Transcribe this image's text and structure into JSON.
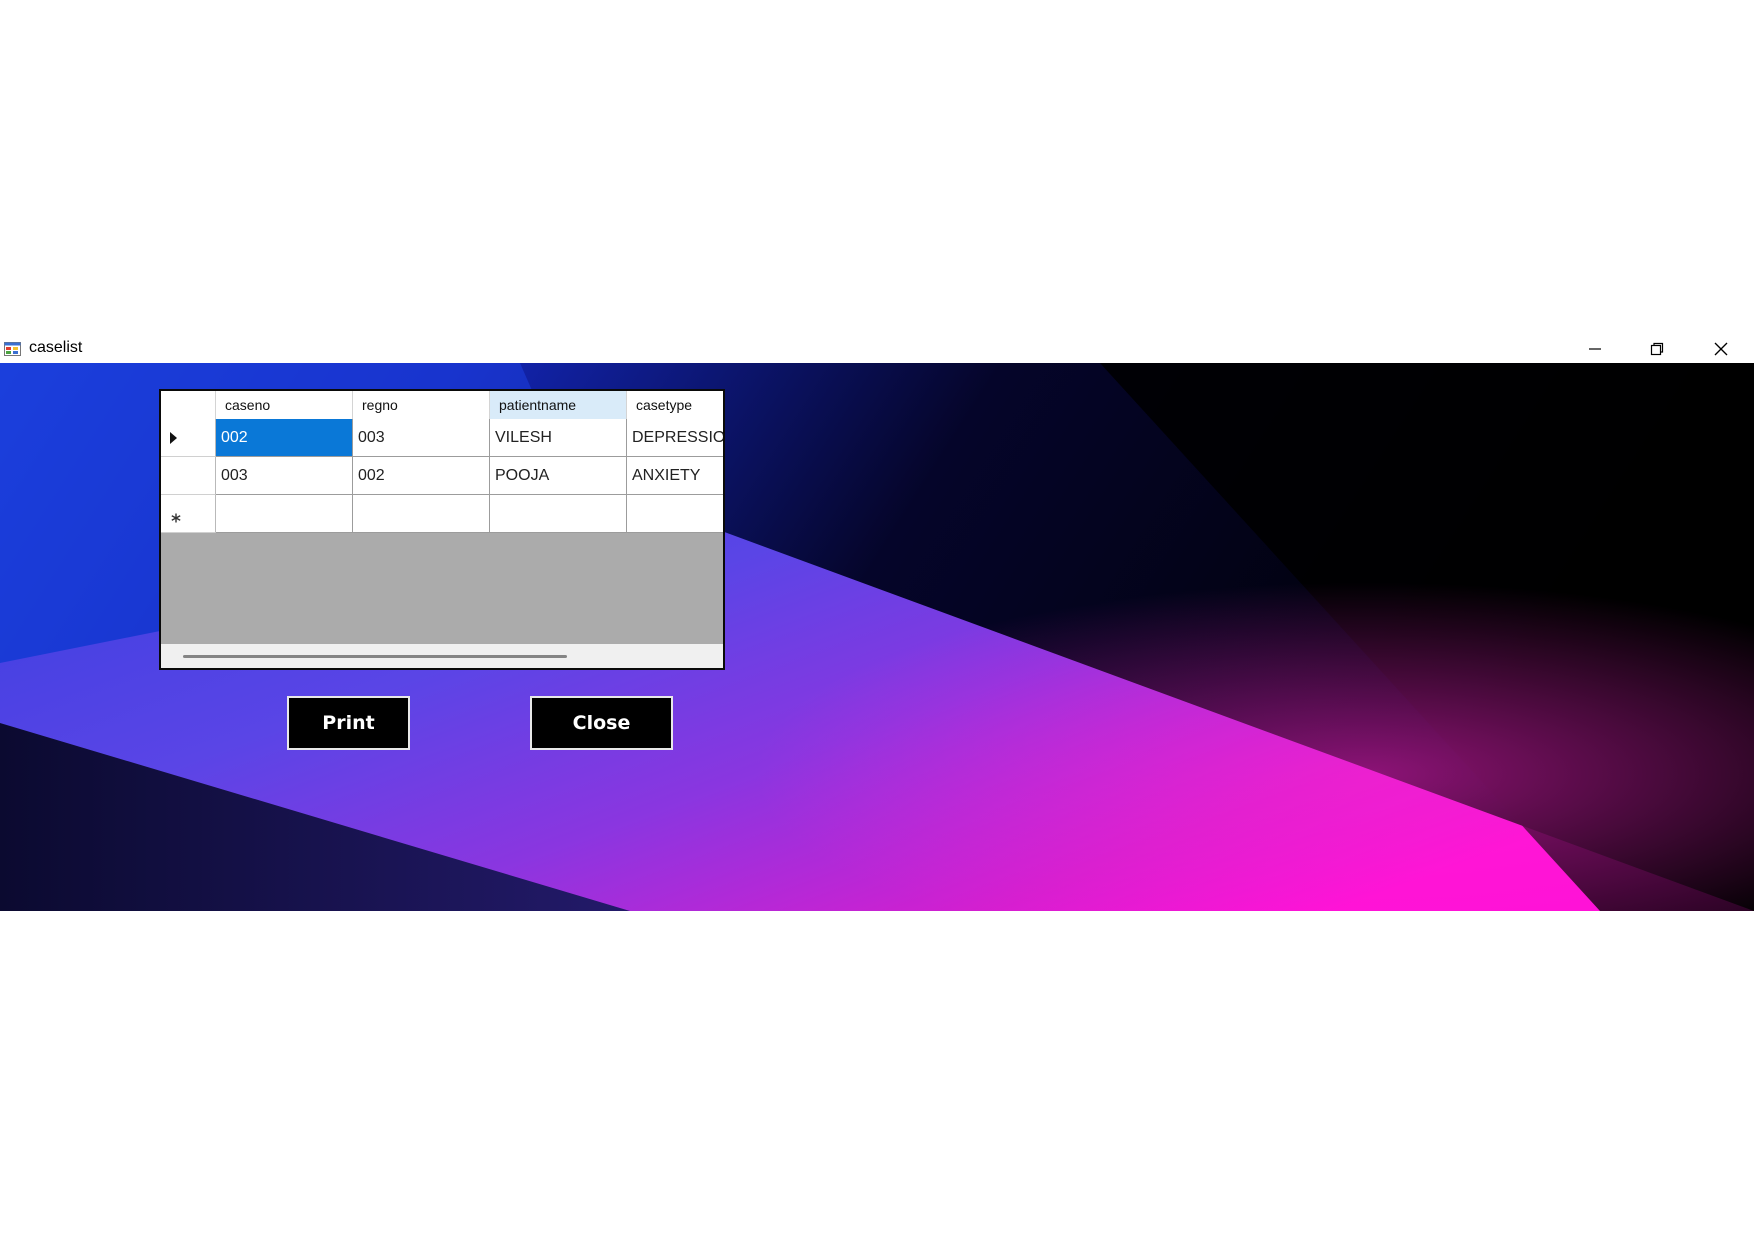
{
  "window": {
    "title": "caselist",
    "icon": "app-form-icon",
    "controls": {
      "minimize_icon": "minimize-icon",
      "maximize_icon": "restore-icon",
      "close_icon": "close-icon"
    }
  },
  "grid": {
    "columns": [
      {
        "key": "caseno",
        "label": "caseno"
      },
      {
        "key": "regno",
        "label": "regno"
      },
      {
        "key": "patientname",
        "label": "patientname",
        "highlighted": true
      },
      {
        "key": "casetype",
        "label": "casetype"
      }
    ],
    "rows": [
      {
        "caseno": "002",
        "regno": "003",
        "patientname": "VILESH",
        "casetype": "DEPRESSION",
        "current": true
      },
      {
        "caseno": "003",
        "regno": "002",
        "patientname": "POOJA",
        "casetype": "ANXIETY"
      }
    ],
    "current_row_icon": "row-pointer-icon",
    "new_row_icon": "new-row-asterisk-icon",
    "selected_cell_color": "#0a78d7",
    "header_highlight_color": "#d9ebf9"
  },
  "buttons": {
    "print_label": "Print",
    "close_label": "Close"
  },
  "colors": {
    "button_background": "#000000",
    "button_text": "#ffffff"
  }
}
